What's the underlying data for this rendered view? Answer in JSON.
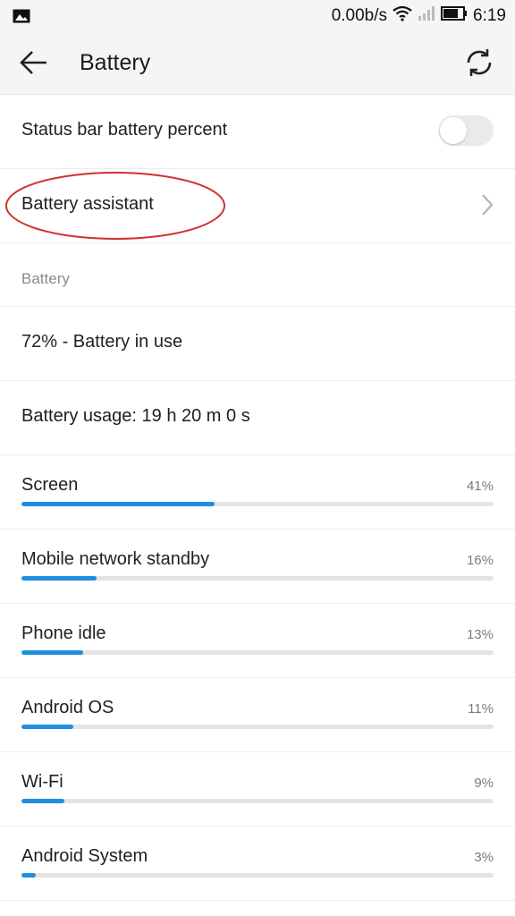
{
  "status_bar": {
    "left_icon": "image-icon",
    "network_speed": "0.00b/s",
    "wifi_icon": "wifi-icon",
    "signal_icon": "signal-icon",
    "battery_icon": "battery-icon",
    "time": "6:19"
  },
  "app_bar": {
    "back_icon": "back-arrow-icon",
    "title": "Battery",
    "refresh_icon": "refresh-icon"
  },
  "settings": {
    "status_bar_percent": {
      "label": "Status bar battery percent",
      "enabled": false
    },
    "battery_assistant": {
      "label": "Battery assistant",
      "icon": "chevron-right-icon"
    }
  },
  "battery_section": {
    "header": "Battery",
    "status": "72% - Battery in use",
    "usage_time": "Battery usage: 19 h 20 m 0 s"
  },
  "usage_items": [
    {
      "name": "Screen",
      "percent_label": "41%",
      "percent": 41
    },
    {
      "name": "Mobile network standby",
      "percent_label": "16%",
      "percent": 16
    },
    {
      "name": "Phone idle",
      "percent_label": "13%",
      "percent": 13
    },
    {
      "name": "Android OS",
      "percent_label": "11%",
      "percent": 11
    },
    {
      "name": "Wi-Fi",
      "percent_label": "9%",
      "percent": 9
    },
    {
      "name": "Android System",
      "percent_label": "3%",
      "percent": 3
    }
  ],
  "colors": {
    "accent": "#1e8fe0",
    "annotation": "#d0312d"
  }
}
